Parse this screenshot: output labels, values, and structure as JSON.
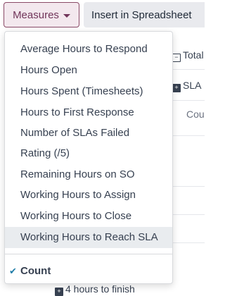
{
  "toolbar": {
    "measures_label": "Measures",
    "insert_label": "Insert in Spreadsheet"
  },
  "background": {
    "total_header": "Total",
    "sla_header": "SLA",
    "count_header": "Cou",
    "row_bottom": "4 hours to finish"
  },
  "measures_menu": {
    "items": [
      "Average Hours to Respond",
      "Hours Open",
      "Hours Spent (Timesheets)",
      "Hours to First Response",
      "Number of SLAs Failed",
      "Rating (/5)",
      "Remaining Hours on SO",
      "Working Hours to Assign",
      "Working Hours to Close",
      "Working Hours to Reach SLA"
    ],
    "hovered_item": "Working Hours to Reach SLA",
    "selected": "Count",
    "check_icon": "check-icon"
  },
  "colors": {
    "accent": "#71355a",
    "check": "#1f7da8",
    "hover": "#e9ecef"
  }
}
